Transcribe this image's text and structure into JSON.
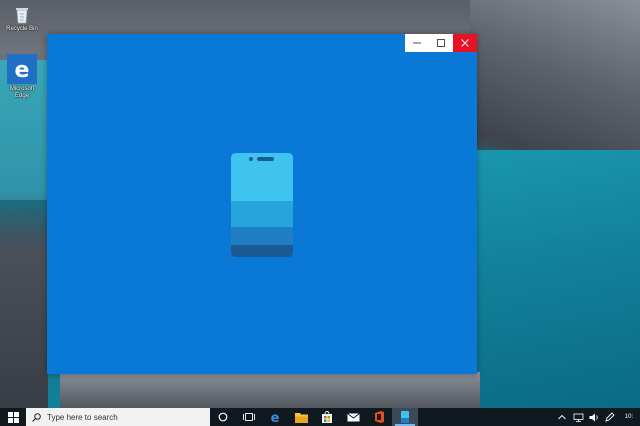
{
  "desktop": {
    "icons": [
      {
        "label": "Recycle Bin",
        "icon": "recycle-bin-icon"
      },
      {
        "label": "Microsoft Edge",
        "icon": "edge-icon"
      }
    ]
  },
  "app_window": {
    "title": "",
    "background_color": "#0a78d6",
    "splash_icon": "phone-icon",
    "controls": [
      {
        "name": "minimize",
        "glyph": "—"
      },
      {
        "name": "maximize",
        "glyph": "☐"
      },
      {
        "name": "close",
        "glyph": "✕"
      }
    ]
  },
  "taskbar": {
    "search_placeholder": "Type here to search",
    "pinned_apps": [
      "cortana-icon",
      "task-view-icon",
      "edge-icon",
      "file-explorer-icon",
      "store-icon",
      "mail-icon",
      "office-icon",
      "your-phone-icon"
    ],
    "active_app": "your-phone-icon",
    "tray": [
      "chevron-up-icon",
      "network-icon",
      "volume-icon",
      "pen-icon"
    ],
    "clock": "10:"
  }
}
